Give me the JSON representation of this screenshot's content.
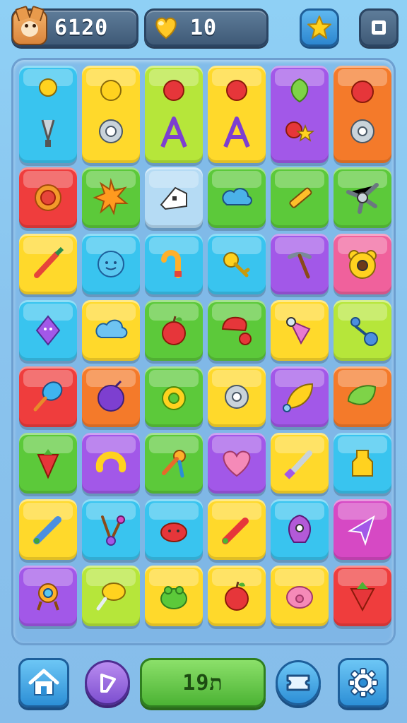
{
  "hud": {
    "score": "6120",
    "lives": "10"
  },
  "bottom_bar": {
    "moves": "19ת"
  },
  "colors": {
    "cyan": "#39c4ef",
    "yellow": "#ffd92b",
    "lime": "#b6e63a",
    "purple": "#a258e8",
    "red": "#ef3d3d",
    "orange": "#f47a2a",
    "green": "#5cc93a",
    "pink": "#f0619c",
    "lightblue": "#b5dbf4",
    "magenta": "#d649c4"
  },
  "board": {
    "tiles": [
      {
        "color": "cyan",
        "icon": "lemon-drop-and-whisk",
        "tall": true
      },
      {
        "color": "yellow",
        "icon": "sun-and-ring",
        "tall": true
      },
      {
        "color": "lime",
        "icon": "balloon-and-letter-a",
        "tall": true
      },
      {
        "color": "yellow",
        "icon": "balloon-and-letter-a",
        "tall": true
      },
      {
        "color": "purple",
        "icon": "leaf-and-star",
        "tall": true
      },
      {
        "color": "orange",
        "icon": "apple-and-gear",
        "tall": true
      },
      {
        "color": "red",
        "icon": "orange-ball"
      },
      {
        "color": "green",
        "icon": "spiky-star"
      },
      {
        "color": "lightblue",
        "icon": "eraser"
      },
      {
        "color": "green",
        "icon": "cloud-knot"
      },
      {
        "color": "green",
        "icon": "crayon"
      },
      {
        "color": "green",
        "icon": "satellite"
      },
      {
        "color": "yellow",
        "icon": "dart"
      },
      {
        "color": "cyan",
        "icon": "smiley-ball"
      },
      {
        "color": "cyan",
        "icon": "candy-cane"
      },
      {
        "color": "cyan",
        "icon": "key"
      },
      {
        "color": "purple",
        "icon": "pickaxe"
      },
      {
        "color": "pink",
        "icon": "bear-face"
      },
      {
        "color": "cyan",
        "icon": "purple-creature"
      },
      {
        "color": "yellow",
        "icon": "blue-cloud"
      },
      {
        "color": "green",
        "icon": "red-apple"
      },
      {
        "color": "green",
        "icon": "red-mushroom"
      },
      {
        "color": "yellow",
        "icon": "ice-cream"
      },
      {
        "color": "lime",
        "icon": "rattle"
      },
      {
        "color": "red",
        "icon": "blue-spoon"
      },
      {
        "color": "orange",
        "icon": "purple-plum"
      },
      {
        "color": "green",
        "icon": "yellow-ring"
      },
      {
        "color": "yellow",
        "icon": "gear"
      },
      {
        "color": "purple",
        "icon": "yellow-leaf"
      },
      {
        "color": "orange",
        "icon": "green-mango"
      },
      {
        "color": "green",
        "icon": "strawberry"
      },
      {
        "color": "purple",
        "icon": "yellow-horseshoe"
      },
      {
        "color": "green",
        "icon": "maraca"
      },
      {
        "color": "purple",
        "icon": "pink-heart"
      },
      {
        "color": "yellow",
        "icon": "hammer"
      },
      {
        "color": "cyan",
        "icon": "bottle"
      },
      {
        "color": "yellow",
        "icon": "blue-pencil"
      },
      {
        "color": "cyan",
        "icon": "drumsticks"
      },
      {
        "color": "cyan",
        "icon": "red-crab"
      },
      {
        "color": "yellow",
        "icon": "red-crayon"
      },
      {
        "color": "cyan",
        "icon": "purple-monster"
      },
      {
        "color": "magenta",
        "icon": "arrow-cursor"
      },
      {
        "color": "purple",
        "icon": "scissors-ring"
      },
      {
        "color": "lime",
        "icon": "yellow-lollipop"
      },
      {
        "color": "yellow",
        "icon": "green-frog"
      },
      {
        "color": "yellow",
        "icon": "red-apple-2"
      },
      {
        "color": "yellow",
        "icon": "pink-pig"
      },
      {
        "color": "red",
        "icon": "strawberry-2"
      }
    ]
  }
}
